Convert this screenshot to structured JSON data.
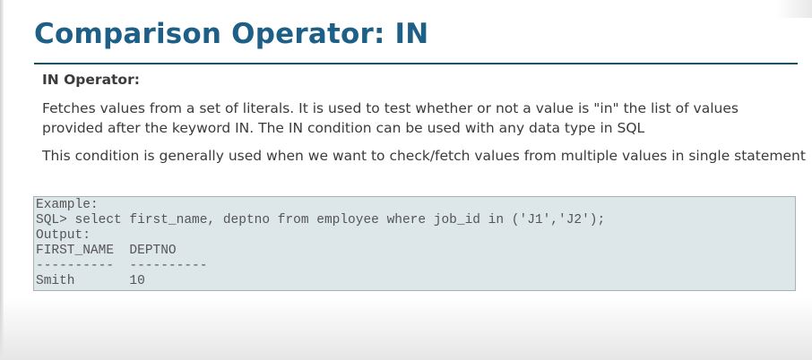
{
  "slide": {
    "title": "Comparison Operator: IN",
    "heading": "IN Operator:",
    "paragraph1": "Fetches values from a set of literals. It is used to test whether or not a value is \"in\" the list of values provided after the keyword IN. The IN condition can be used with any data type in SQL",
    "paragraph2": "This condition is generally used when we want to check/fetch values from multiple values in single statement"
  },
  "code": {
    "lines": [
      "Example:",
      "SQL> select first_name, deptno from employee where job_id in ('J1','J2');",
      "Output:",
      "FIRST_NAME  DEPTNO",
      "----------  ----------",
      "Smith       10"
    ]
  },
  "colors": {
    "title": "#1d5f86",
    "rule": "#1d4f66",
    "body_text": "#3b3b3b",
    "code_background": "#dde6e9",
    "code_text": "#555555"
  }
}
